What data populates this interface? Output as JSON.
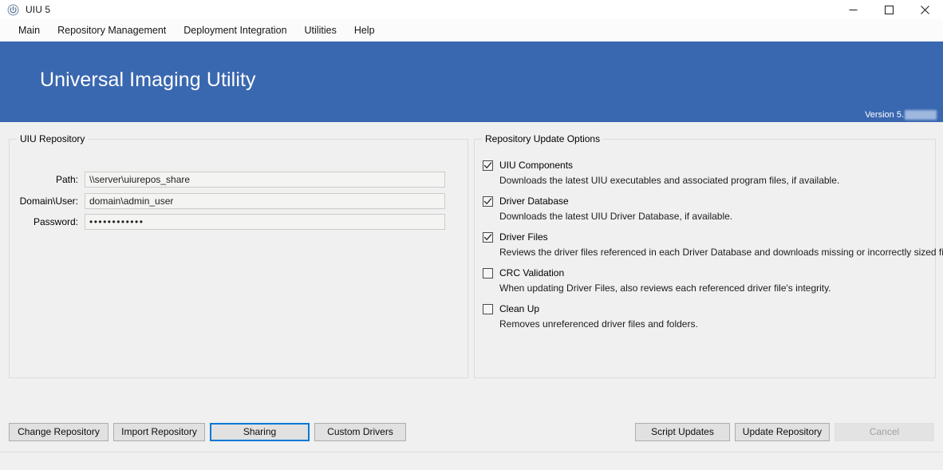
{
  "window": {
    "title": "UIU 5",
    "icon": "power-circle-icon",
    "controls": {
      "minimize": "minimize-icon",
      "maximize": "maximize-icon",
      "close": "close-icon"
    }
  },
  "menubar": {
    "items": [
      {
        "label": "Main"
      },
      {
        "label": "Repository Management"
      },
      {
        "label": "Deployment Integration"
      },
      {
        "label": "Utilities"
      },
      {
        "label": "Help"
      }
    ]
  },
  "banner": {
    "title": "Universal Imaging Utility",
    "version_label": "Version 5.",
    "version_redacted": "",
    "background_color": "#3a68b0"
  },
  "repository": {
    "group_title": "UIU Repository",
    "fields": [
      {
        "label": "Path:",
        "value": "\\\\server\\uiurepos_share",
        "placeholder": "",
        "type": "text"
      },
      {
        "label": "Domain\\User:",
        "value": "domain\\admin_user",
        "placeholder": "",
        "type": "text"
      },
      {
        "label": "Password:",
        "value": "••••••••••••",
        "placeholder": "",
        "type": "password"
      }
    ]
  },
  "update_options": {
    "group_title": "Repository Update Options",
    "items": [
      {
        "label": "UIU Components",
        "checked": true,
        "description": "Downloads the latest UIU executables and associated program files, if available."
      },
      {
        "label": "Driver Database",
        "checked": true,
        "description": "Downloads the latest UIU Driver Database, if available."
      },
      {
        "label": "Driver Files",
        "checked": true,
        "description": "Reviews the driver files referenced in each Driver Database and downloads missing or incorrectly sized files."
      },
      {
        "label": "CRC Validation",
        "checked": false,
        "description": "When updating Driver Files, also reviews each referenced driver file's integrity."
      },
      {
        "label": "Clean Up",
        "checked": false,
        "description": "Removes unreferenced driver files and folders."
      }
    ]
  },
  "buttons": {
    "left": [
      {
        "label": "Change Repository",
        "state": "normal"
      },
      {
        "label": "Import Repository",
        "state": "normal"
      },
      {
        "label": "Sharing",
        "state": "focused"
      },
      {
        "label": "Custom Drivers",
        "state": "normal"
      }
    ],
    "right": [
      {
        "label": "Script Updates",
        "state": "normal"
      },
      {
        "label": "Update Repository",
        "state": "normal"
      },
      {
        "label": "Cancel",
        "state": "disabled"
      }
    ]
  },
  "colors": {
    "accent": "#3a68b0",
    "focus": "#0078d7",
    "window_bg": "#f0f0f0"
  }
}
